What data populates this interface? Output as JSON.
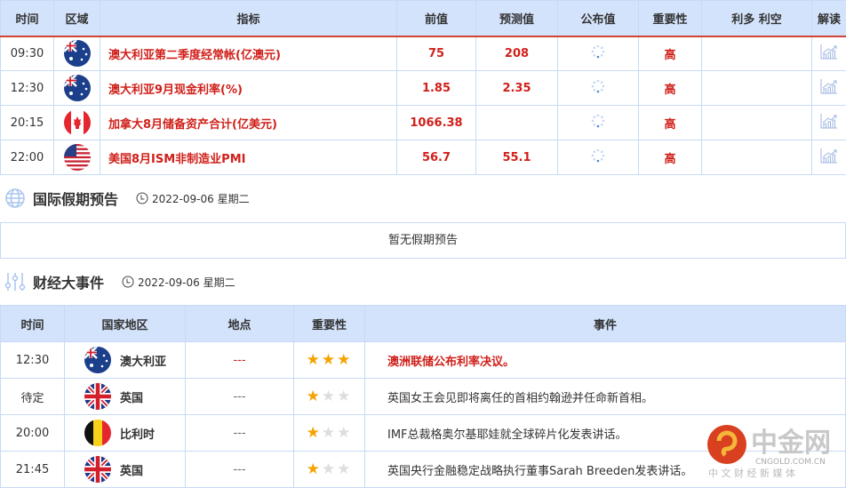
{
  "calendar": {
    "headers": [
      "时间",
      "区域",
      "指标",
      "前值",
      "预测值",
      "公布值",
      "重要性",
      "利多 利空",
      "解读"
    ],
    "rows": [
      {
        "time": "09:30",
        "flag": "australia",
        "indicator": "澳大利亚第二季度经常帐(亿澳元)",
        "previous": "75",
        "forecast": "208",
        "importance": "高"
      },
      {
        "time": "12:30",
        "flag": "australia",
        "indicator": "澳大利亚9月现金利率(%)",
        "previous": "1.85",
        "forecast": "2.35",
        "importance": "高"
      },
      {
        "time": "20:15",
        "flag": "canada",
        "indicator": "加拿大8月储备资产合计(亿美元)",
        "previous": "1066.38",
        "forecast": "",
        "importance": "高"
      },
      {
        "time": "22:00",
        "flag": "usa",
        "indicator": "美国8月ISM非制造业PMI",
        "previous": "56.7",
        "forecast": "55.1",
        "importance": "高"
      }
    ]
  },
  "holidays": {
    "title": "国际假期预告",
    "date": "2022-09-06 星期二",
    "empty": "暂无假期预告"
  },
  "events": {
    "title": "财经大事件",
    "date": "2022-09-06 星期二",
    "headers": [
      "时间",
      "国家地区",
      "地点",
      "重要性",
      "事件"
    ],
    "rows": [
      {
        "time": "12:30",
        "flag": "australia",
        "country": "澳大利亚",
        "place": "---",
        "stars": 3,
        "event": "澳洲联储公布利率决议。",
        "highlight": true
      },
      {
        "time": "待定",
        "flag": "uk",
        "country": "英国",
        "place": "---",
        "stars": 1,
        "event": "英国女王会见即将离任的首相约翰逊并任命新首相。"
      },
      {
        "time": "20:00",
        "flag": "belgium",
        "country": "比利时",
        "place": "---",
        "stars": 1,
        "event": "IMF总裁格奥尔基耶娃就全球碎片化发表讲话。"
      },
      {
        "time": "21:45",
        "flag": "uk",
        "country": "英国",
        "place": "---",
        "stars": 1,
        "event": "英国央行金融稳定战略执行董事Sarah Breeden发表讲话。"
      }
    ]
  },
  "watermark": {
    "name": "中金网",
    "domain": "CNGOLD.COM.CN",
    "slogan": "中 文 财 经 新 媒 体"
  },
  "colors": {
    "accent_red": "#d0201a",
    "header_bg": "#d3e3fb",
    "border": "#c7daf5",
    "star": "#f5a300"
  }
}
